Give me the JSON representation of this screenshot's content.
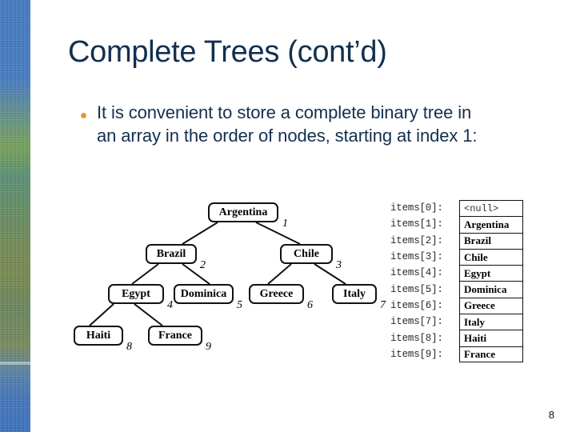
{
  "slide": {
    "title": "Complete Trees (cont’d)",
    "page_number": "8",
    "title_color": "#12304f",
    "bullet_color": "#e09b38",
    "bullets": [
      "It is convenient to store a complete binary tree in an array in the order of nodes, starting at index 1:"
    ]
  },
  "tree": {
    "nodes": [
      {
        "label": "Argentina",
        "index": "1"
      },
      {
        "label": "Brazil",
        "index": "2"
      },
      {
        "label": "Chile",
        "index": "3"
      },
      {
        "label": "Egypt",
        "index": "4"
      },
      {
        "label": "Dominica",
        "index": "5"
      },
      {
        "label": "Greece",
        "index": "6"
      },
      {
        "label": "Italy",
        "index": "7"
      },
      {
        "label": "Haiti",
        "index": "8"
      },
      {
        "label": "France",
        "index": "9"
      }
    ]
  },
  "array": {
    "rows": [
      {
        "label": "items[0]:",
        "value": "<null>"
      },
      {
        "label": "items[1]:",
        "value": "Argentina"
      },
      {
        "label": "items[2]:",
        "value": "Brazil"
      },
      {
        "label": "items[3]:",
        "value": "Chile"
      },
      {
        "label": "items[4]:",
        "value": "Egypt"
      },
      {
        "label": "items[5]:",
        "value": "Dominica"
      },
      {
        "label": "items[6]:",
        "value": "Greece"
      },
      {
        "label": "items[7]:",
        "value": "Italy"
      },
      {
        "label": "items[8]:",
        "value": "Haiti"
      },
      {
        "label": "items[9]:",
        "value": "France"
      }
    ]
  }
}
